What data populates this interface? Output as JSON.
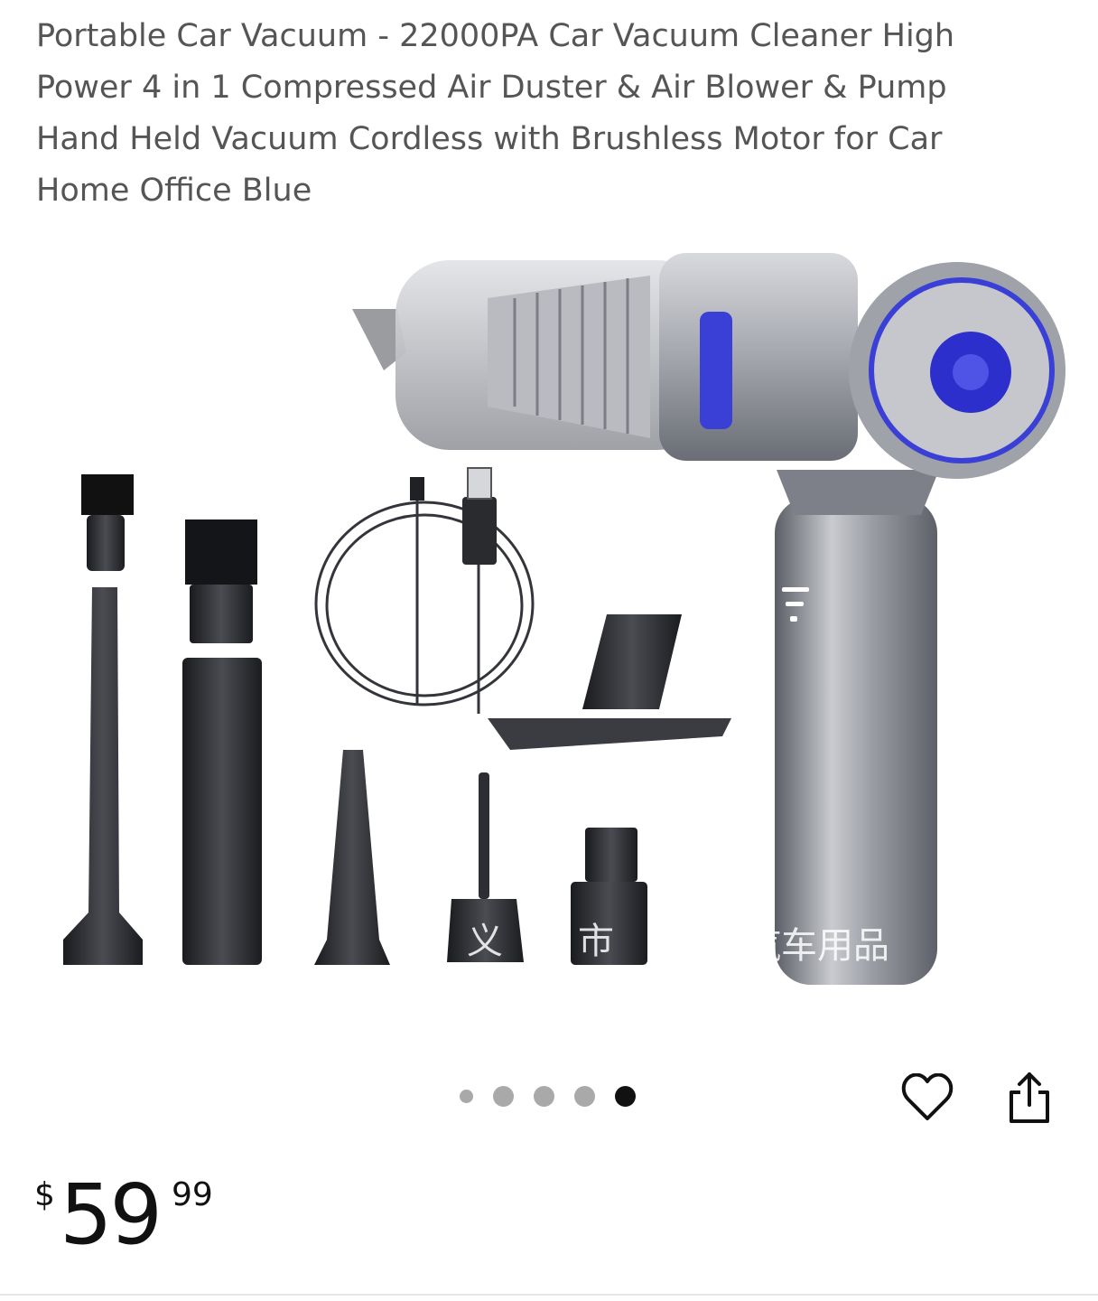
{
  "product": {
    "title": "Portable Car Vacuum - 22000PA Car Vacuum Cleaner High Power 4 in 1 Compressed Air Duster & Air Blower & Pump Hand Held Vacuum Cordless with Brushless Motor for Car Home Office Blue"
  },
  "image": {
    "watermark": [
      "义",
      "市",
      "汽车用品"
    ]
  },
  "carousel": {
    "total": 5,
    "active_index": 4
  },
  "actions": {
    "favorite_icon": "heart-outline-icon",
    "share_icon": "share-icon"
  },
  "price": {
    "currency": "$",
    "whole": "59",
    "fraction": "99"
  }
}
